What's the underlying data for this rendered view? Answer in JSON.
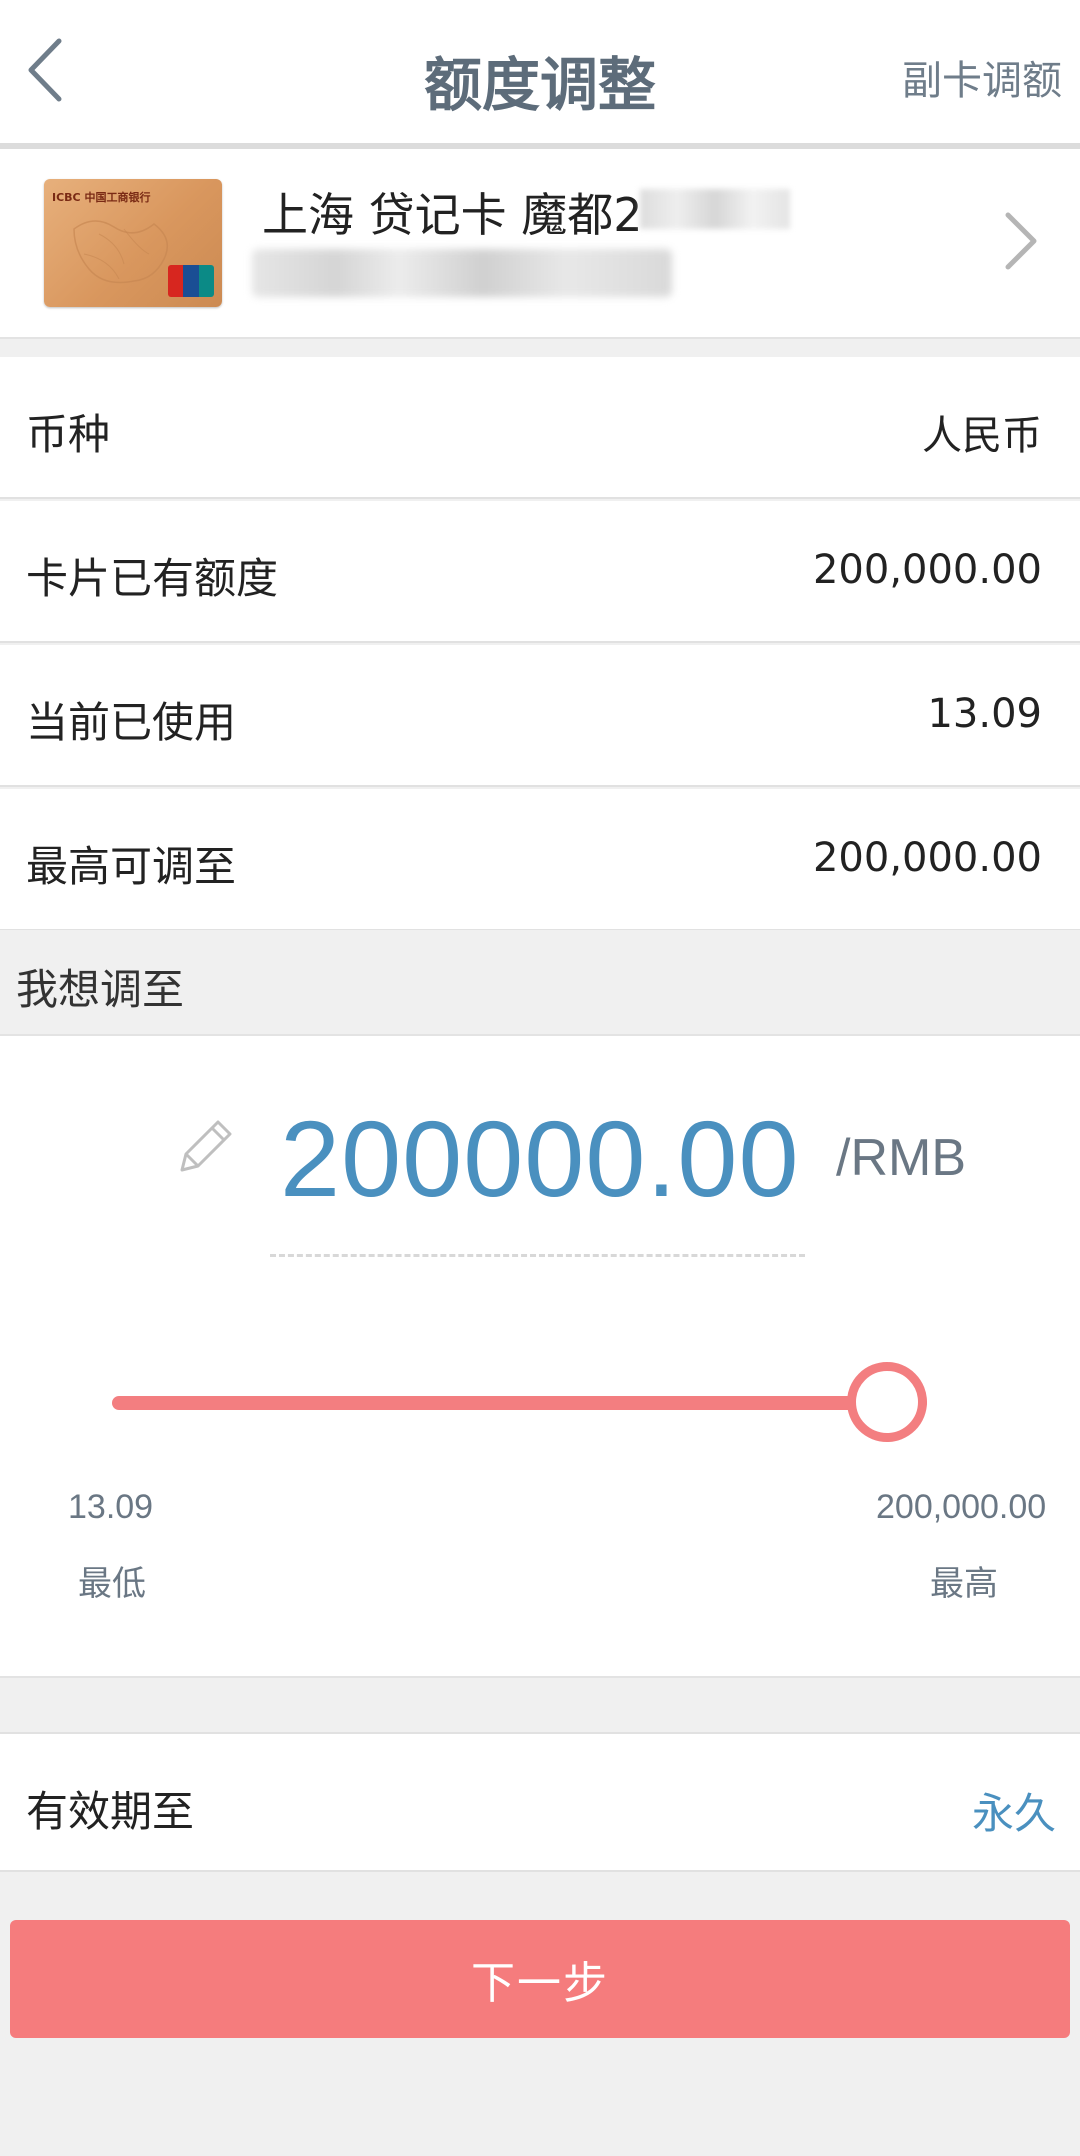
{
  "header": {
    "title": "额度调整",
    "sub_card_link": "副卡调额"
  },
  "card": {
    "bank_text": "ICBC 中国工商银行",
    "name": "上海 贷记卡 魔都2",
    "number": ""
  },
  "info_rows": [
    {
      "label": "币种",
      "value": "人民币"
    },
    {
      "label": "卡片已有额度",
      "value": "200,000.00"
    },
    {
      "label": "当前已使用",
      "value": "13.09"
    },
    {
      "label": "最高可调至",
      "value": "200,000.00"
    }
  ],
  "target": {
    "section_label": "我想调至",
    "amount": "200000.00",
    "unit": "/RMB"
  },
  "slider": {
    "min_value": "13.09",
    "min_label": "最低",
    "max_value": "200,000.00",
    "max_label": "最高",
    "level": 1.0
  },
  "validity": {
    "label": "有效期至",
    "value": "永久"
  },
  "next_button": {
    "label": "下一步"
  },
  "colors": {
    "accent_blue": "#4a90bf",
    "accent_red": "#f57c7d",
    "title_gray": "#5d6c7a"
  },
  "icons": [
    "back-arrow-icon",
    "chevron-right-icon",
    "pencil-icon",
    "unionpay-logo"
  ]
}
